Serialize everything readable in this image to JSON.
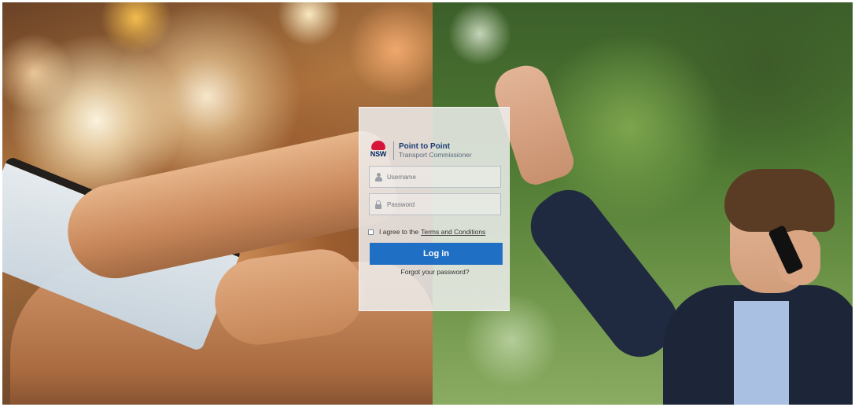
{
  "brand": {
    "logo_text": "NSW",
    "title": "Point to Point",
    "subtitle": "Transport Commissioner"
  },
  "login": {
    "username_placeholder": "Username",
    "password_placeholder": "Password",
    "agree_prefix": "I agree to the",
    "terms_link": "Terms and Conditions",
    "login_button": "Log in",
    "forgot_link": "Forgot your password?"
  },
  "colors": {
    "button": "#1f6fc4",
    "brand_navy": "#1c3b73",
    "nsw_red": "#d7153a"
  }
}
